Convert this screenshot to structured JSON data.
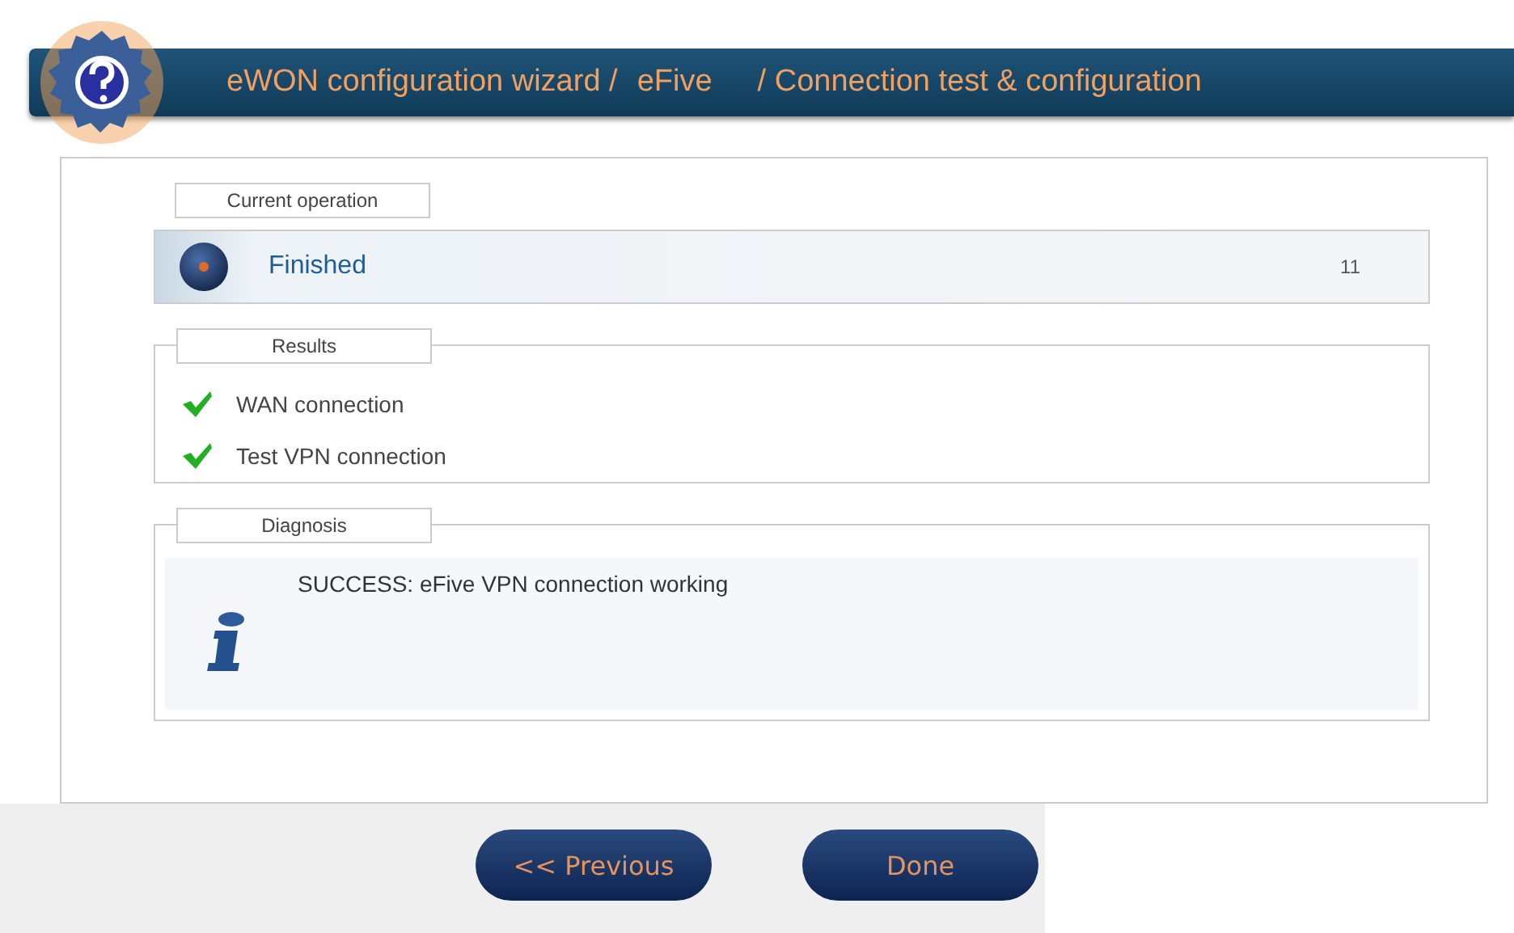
{
  "header": {
    "breadcrumb": [
      "eWON configuration wizard /",
      "eFive",
      "/ Connection test & configuration"
    ]
  },
  "current_operation": {
    "legend": "Current operation",
    "status": "Finished",
    "count": "11"
  },
  "results": {
    "legend": "Results",
    "items": [
      {
        "label": "WAN connection",
        "passed": true
      },
      {
        "label": "Test VPN connection",
        "passed": true
      }
    ]
  },
  "diagnosis": {
    "legend": "Diagnosis",
    "message": "SUCCESS: eFive VPN connection working"
  },
  "buttons": [
    {
      "label": "<< Previous"
    },
    {
      "label": "Done"
    }
  ]
}
